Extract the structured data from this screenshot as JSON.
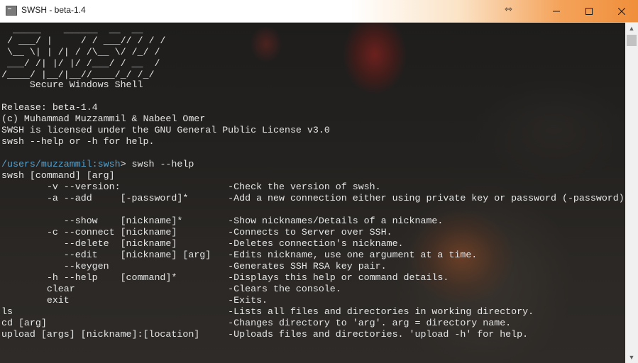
{
  "window": {
    "title": "SWSH - beta-1.4",
    "resize_glyph": "⇿",
    "controls": [
      "minimize",
      "maximize",
      "close"
    ]
  },
  "console": {
    "banner": [
      "  _____    ______  __  __",
      " / ___/ |     / / ___// / / /",
      " \\__ \\| | /| / /\\__ \\/ /_/ /",
      " ___/ /| |/ |/ /___/ / __  /",
      "/____/ |__/|__//____/_/ /_/",
      "     Secure Windows Shell"
    ],
    "info": [
      "Release: beta-1.4",
      "(c) Muhammad Muzzammil & Nabeel Omer",
      "SWSH is licensed under the GNU General Public License v3.0",
      "swsh --help or -h for help."
    ],
    "prompt_path": "/users/muzzammil:swsh",
    "prompt_sep": "> ",
    "command": "swsh --help",
    "help": [
      "swsh [command] [arg]",
      "        -v --version:                   -Check the version of swsh.",
      "        -a --add     [-password]*       -Add a new connection either using private key or password (-password).",
      "",
      "           --show    [nickname]*        -Show nicknames/Details of a nickname.",
      "        -c --connect [nickname]         -Connects to Server over SSH.",
      "           --delete  [nickname]         -Deletes connection's nickname.",
      "           --edit    [nickname] [arg]   -Edits nickname, use one argument at a time.",
      "           --keygen                     -Generates SSH RSA key pair.",
      "        -h --help    [command]*         -Displays this help or command details.",
      "        clear                           -Clears the console.",
      "        exit                            -Exits.",
      "ls                                      -Lists all files and directories in working directory.",
      "cd [arg]                                -Changes directory to 'arg'. arg = directory name.",
      "upload [args] [nickname]:[location]     -Uploads files and directories. 'upload -h' for help."
    ]
  },
  "scrollbar": {
    "up_icon": "▲",
    "down_icon": "▼"
  }
}
